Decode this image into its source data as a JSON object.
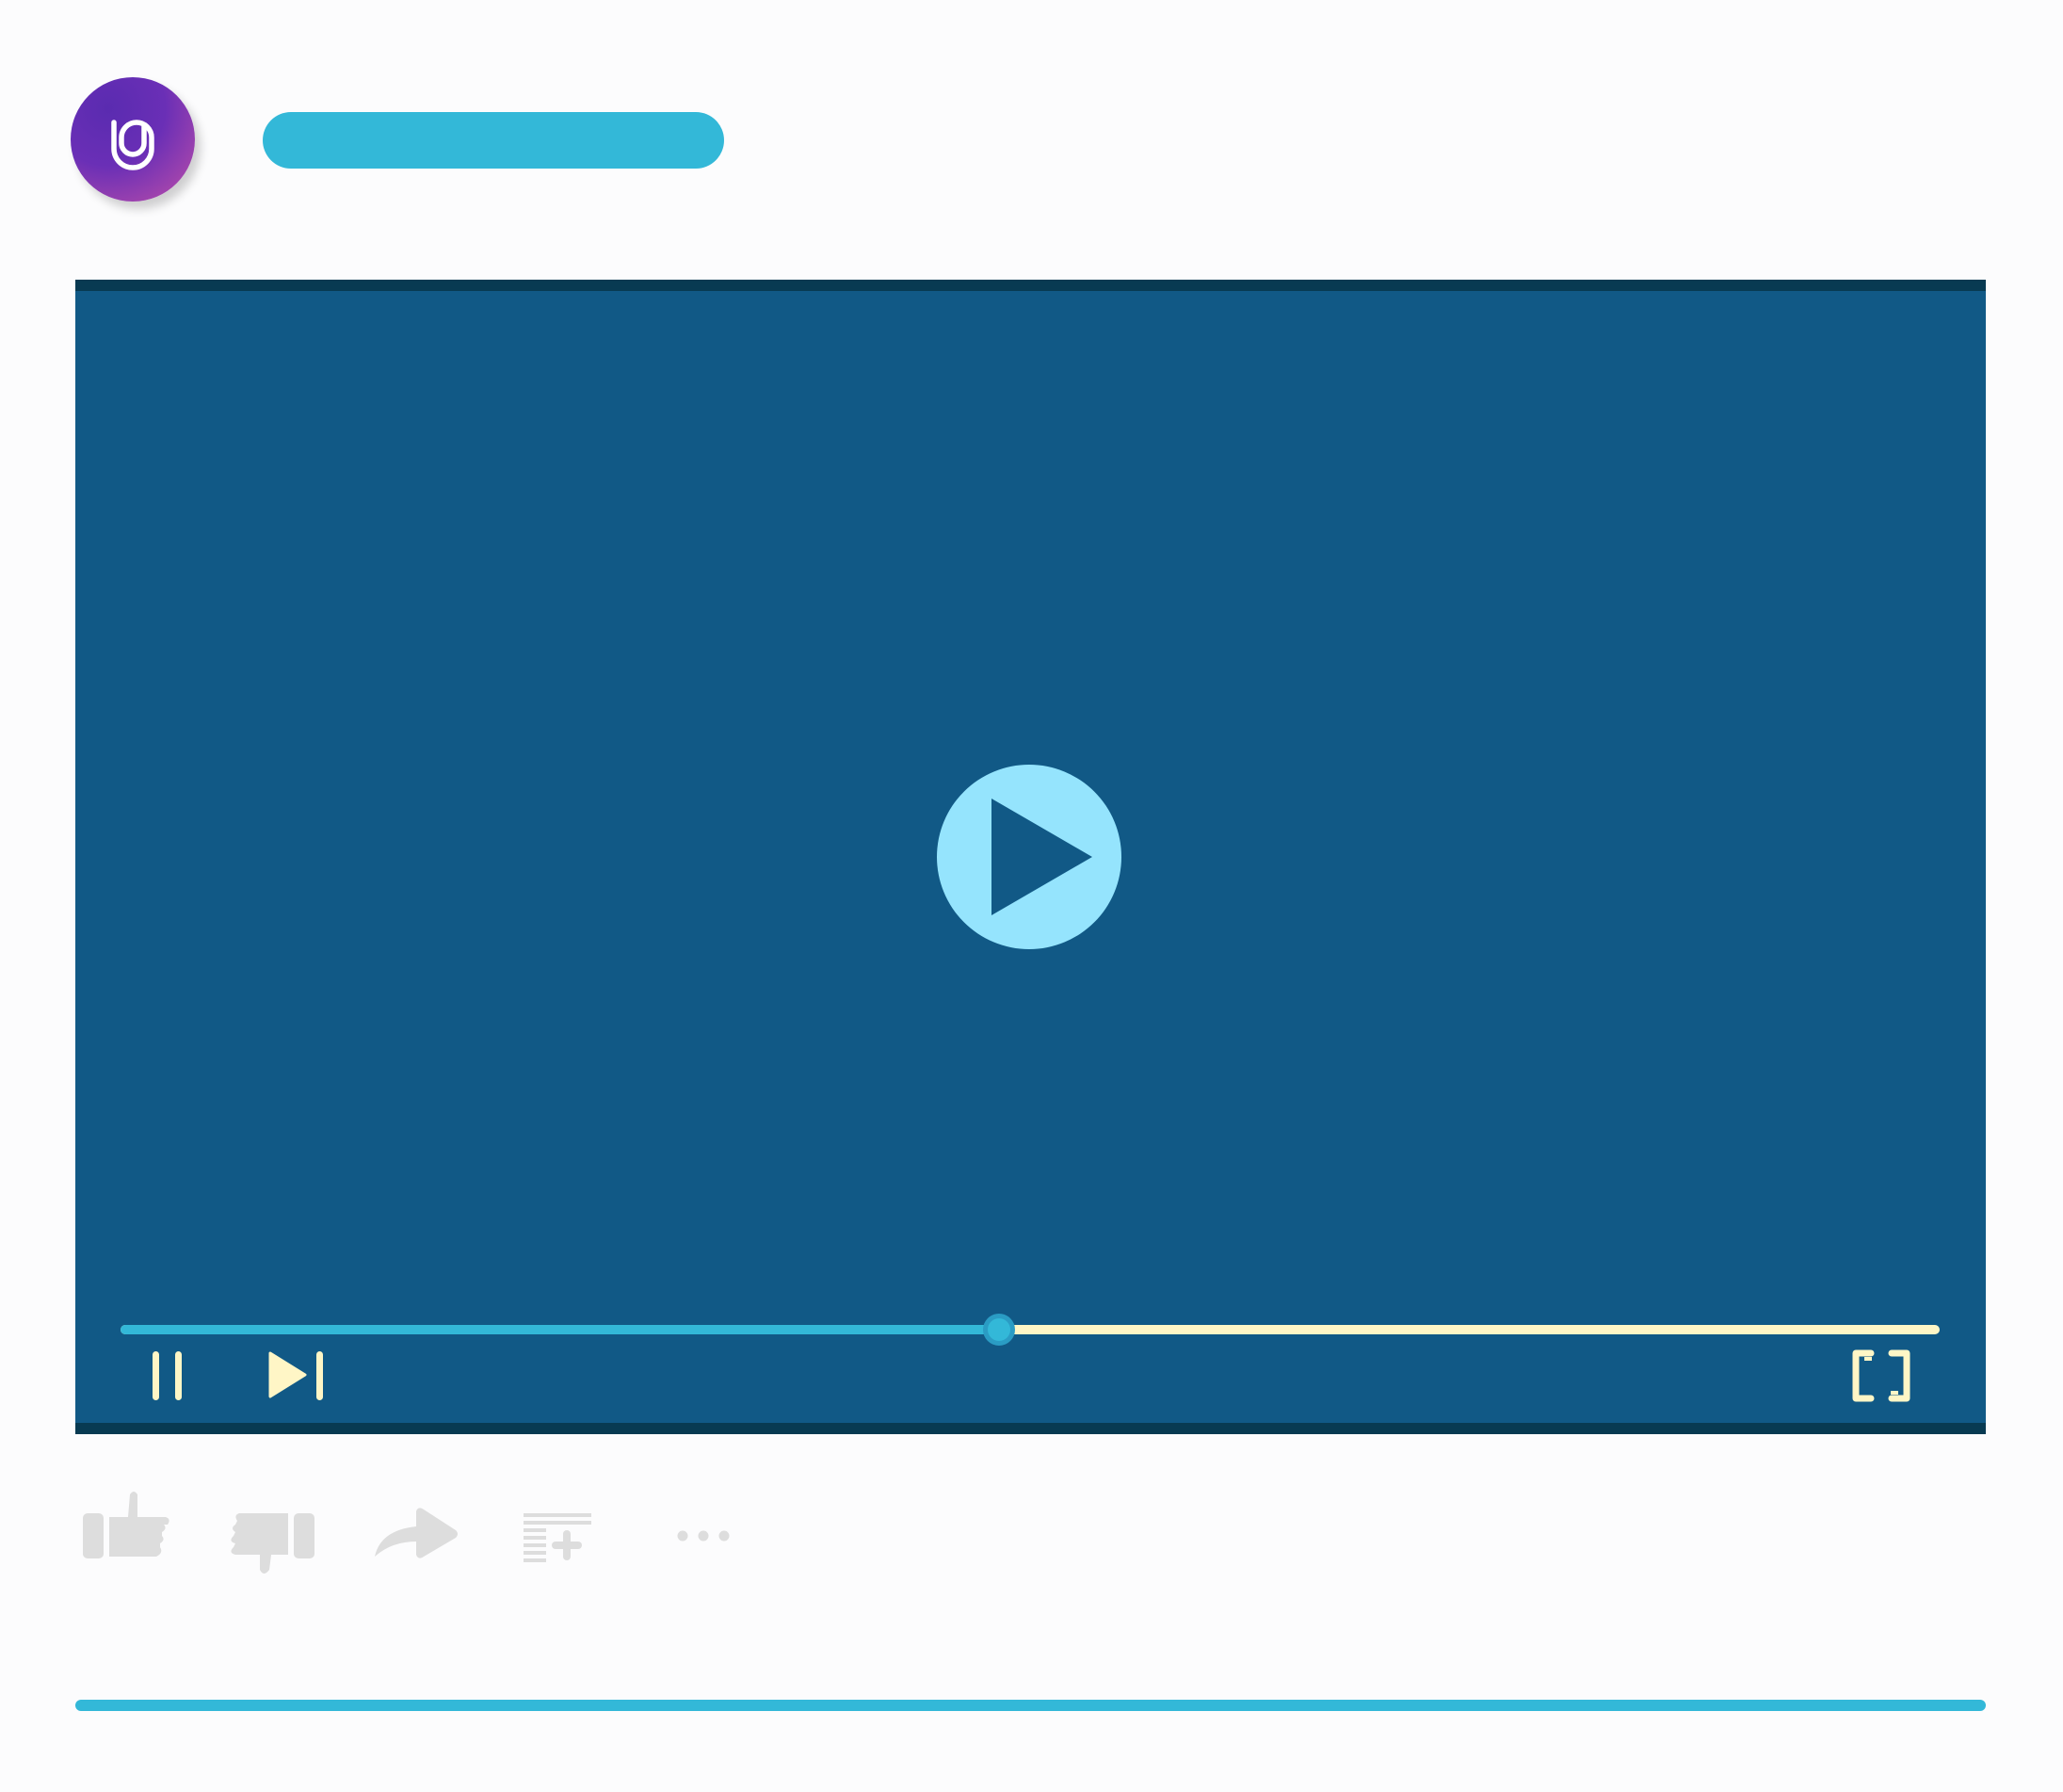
{
  "colors": {
    "page_background": "#fcfcfd",
    "accent": "#33b8d8",
    "player_background": "#115986",
    "player_edge": "#083a52",
    "play_button": "#95e4fd",
    "controls": "#fff6c6",
    "action_icons": "#dddddd"
  },
  "header": {
    "avatar_icon": "spiral-logo-icon",
    "title_placeholder_color": "#33b8d8"
  },
  "player": {
    "progress_fraction": 0.483,
    "big_play_icon": "play-triangle-icon",
    "controls": {
      "pause_icon": "pause-icon",
      "next_icon": "skip-next-icon",
      "fullscreen_icon": "fullscreen-icon"
    }
  },
  "actions": [
    {
      "name": "like",
      "icon": "thumbs-up-icon"
    },
    {
      "name": "dislike",
      "icon": "thumbs-down-icon"
    },
    {
      "name": "share",
      "icon": "share-arrow-icon"
    },
    {
      "name": "save",
      "icon": "playlist-add-icon"
    },
    {
      "name": "more",
      "icon": "more-dots-icon"
    }
  ]
}
